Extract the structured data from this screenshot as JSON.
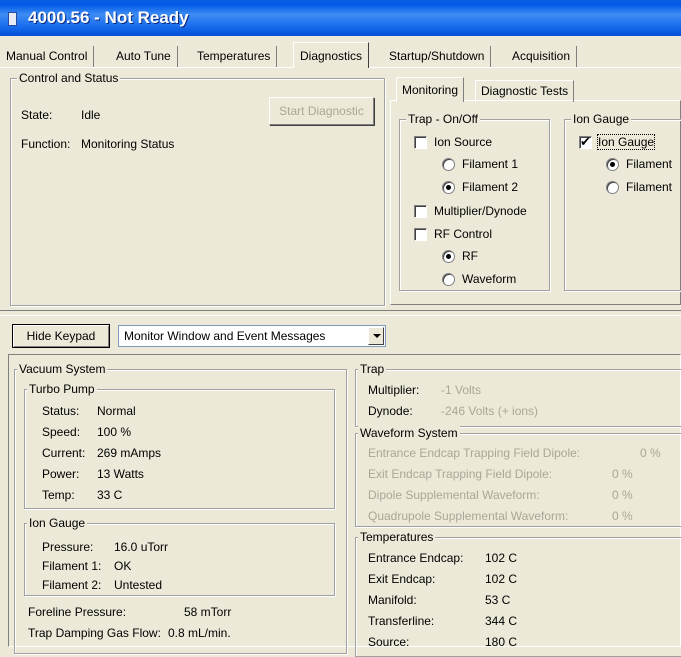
{
  "window": {
    "title": "4000.56 - Not Ready"
  },
  "tabs": [
    "Manual Control",
    "Auto Tune",
    "Temperatures",
    "Diagnostics",
    "Startup/Shutdown",
    "Acquisition"
  ],
  "control_status": {
    "title": "Control and Status",
    "state_label": "State:",
    "state_value": "Idle",
    "function_label": "Function:",
    "function_value": "Monitoring Status",
    "start_button": "Start Diagnostic"
  },
  "subtabs": [
    "Monitoring",
    "Diagnostic Tests"
  ],
  "trap_onoff": {
    "title": "Trap - On/Off",
    "ion_source": "Ion Source",
    "filament1": "Filament 1",
    "filament2": "Filament 2",
    "multiplier": "Multiplier/Dynode",
    "rf_control": "RF Control",
    "rf": "RF",
    "waveform": "Waveform"
  },
  "ion_gauge_top": {
    "title": "Ion Gauge",
    "ion_gauge": "Ion Gauge",
    "filament1": "Filament",
    "filament2": "Filament"
  },
  "toolbar": {
    "hide_keypad": "Hide Keypad",
    "monitor_select": "Monitor Window and Event Messages"
  },
  "vacuum": {
    "title": "Vacuum System",
    "turbo": {
      "title": "Turbo Pump",
      "status_label": "Status:",
      "status_value": "Normal",
      "speed_label": "Speed:",
      "speed_value": "100 %",
      "current_label": "Current:",
      "current_value": "269 mAmps",
      "power_label": "Power:",
      "power_value": "13 Watts",
      "temp_label": "Temp:",
      "temp_value": "33 C"
    },
    "ion_gauge": {
      "title": "Ion Gauge",
      "pressure_label": "Pressure:",
      "pressure_value": "16.0 uTorr",
      "fil1_label": "Filament 1:",
      "fil1_value": "OK",
      "fil2_label": "Filament 2:",
      "fil2_value": "Untested"
    },
    "foreline_label": "Foreline Pressure:",
    "foreline_value": "58 mTorr",
    "damping_label": "Trap Damping Gas Flow:",
    "damping_value": "0.8 mL/min."
  },
  "trap": {
    "title": "Trap",
    "multiplier_label": "Multiplier:",
    "multiplier_value": "-1 Volts",
    "dynode_label": "Dynode:",
    "dynode_value": "-246 Volts (+ ions)"
  },
  "waveform_system": {
    "title": "Waveform System",
    "row1_label": "Entrance Endcap Trapping Field Dipole:",
    "row1_value": "0 %",
    "row2_label": "Exit Endcap Trapping Field Dipole:",
    "row2_value": "0 %",
    "row3_label": "Dipole Supplemental Waveform:",
    "row3_value": "0 %",
    "row4_label": "Quadrupole Supplemental Waveform:",
    "row4_value": "0 %"
  },
  "temperatures": {
    "title": "Temperatures",
    "entrance_label": "Entrance Endcap:",
    "entrance_value": "102 C",
    "exit_label": "Exit Endcap:",
    "exit_value": "102 C",
    "manifold_label": "Manifold:",
    "manifold_value": "53 C",
    "transferline_label": "Transferline:",
    "transferline_value": "344 C",
    "source_label": "Source:",
    "source_value": "180 C"
  },
  "colors": {
    "titlebar": "#0058e6",
    "face": "#ece9d8",
    "disabled_text": "#a9a796"
  }
}
